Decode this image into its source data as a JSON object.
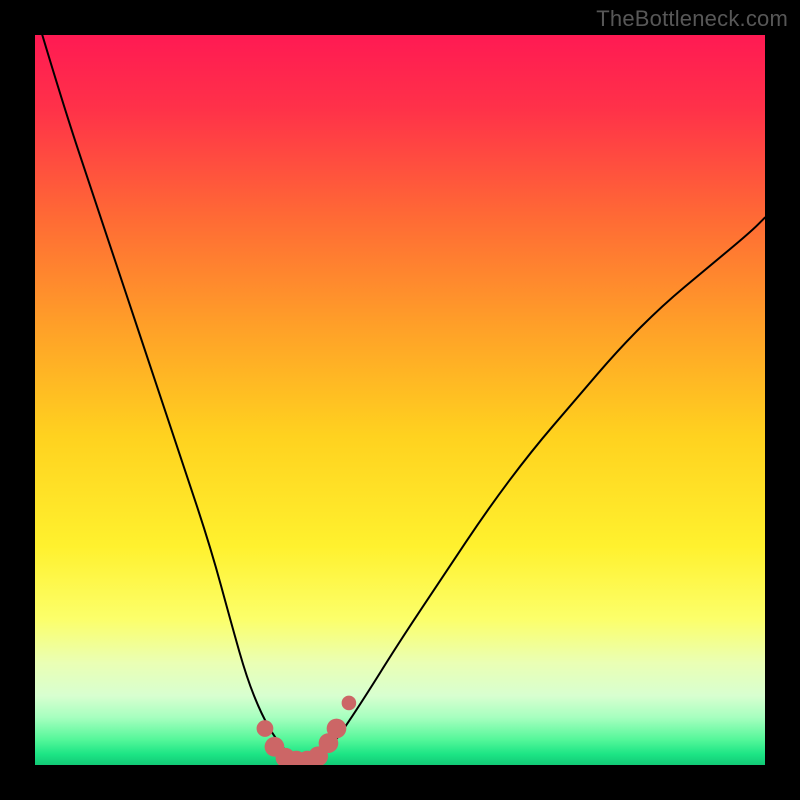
{
  "attribution": "TheBottleneck.com",
  "chart_data": {
    "type": "line",
    "title": "",
    "xlabel": "",
    "ylabel": "",
    "xlim": [
      0,
      100
    ],
    "ylim": [
      0,
      100
    ],
    "note": "No axis ticks, labels, or legend are visible. The curve forms a V-like shape (bottleneck curve): steep descent on the left, flat near the minimum, then a gentler rise to the right. Marked points are clustered around the minimum. Values below are positions estimated from pixels.",
    "series": [
      {
        "name": "bottleneck-curve",
        "x": [
          1,
          4,
          8,
          12,
          16,
          20,
          24,
          27,
          29,
          31,
          33,
          35,
          37,
          39,
          41,
          45,
          50,
          56,
          62,
          68,
          74,
          80,
          86,
          92,
          98,
          100
        ],
        "y": [
          100,
          90,
          78,
          66,
          54,
          42,
          30,
          19,
          12,
          7,
          3.5,
          1.2,
          0.6,
          1.0,
          3.0,
          9,
          17,
          26,
          35,
          43,
          50,
          57,
          63,
          68,
          73,
          75
        ]
      }
    ],
    "markers": {
      "name": "near-minimum-points",
      "color": "#cc6666",
      "points": [
        {
          "x": 31.5,
          "y": 5.0,
          "r": 1.2
        },
        {
          "x": 32.8,
          "y": 2.5,
          "r": 1.6
        },
        {
          "x": 34.3,
          "y": 1.0,
          "r": 1.6
        },
        {
          "x": 35.8,
          "y": 0.6,
          "r": 1.6
        },
        {
          "x": 37.3,
          "y": 0.6,
          "r": 1.6
        },
        {
          "x": 38.8,
          "y": 1.2,
          "r": 1.6
        },
        {
          "x": 40.2,
          "y": 3.0,
          "r": 1.6
        },
        {
          "x": 41.3,
          "y": 5.0,
          "r": 1.6
        },
        {
          "x": 43.0,
          "y": 8.5,
          "r": 0.9
        }
      ]
    },
    "background_gradient": {
      "stops": [
        {
          "offset": 0.0,
          "color": "#ff1a53"
        },
        {
          "offset": 0.1,
          "color": "#ff3149"
        },
        {
          "offset": 0.25,
          "color": "#ff6a35"
        },
        {
          "offset": 0.4,
          "color": "#ffa028"
        },
        {
          "offset": 0.55,
          "color": "#ffd21f"
        },
        {
          "offset": 0.7,
          "color": "#fff12e"
        },
        {
          "offset": 0.8,
          "color": "#fcff6a"
        },
        {
          "offset": 0.86,
          "color": "#eaffb4"
        },
        {
          "offset": 0.905,
          "color": "#d8ffd0"
        },
        {
          "offset": 0.935,
          "color": "#a6ffbf"
        },
        {
          "offset": 0.965,
          "color": "#55f79a"
        },
        {
          "offset": 0.985,
          "color": "#1de585"
        },
        {
          "offset": 1.0,
          "color": "#12c976"
        }
      ]
    }
  }
}
